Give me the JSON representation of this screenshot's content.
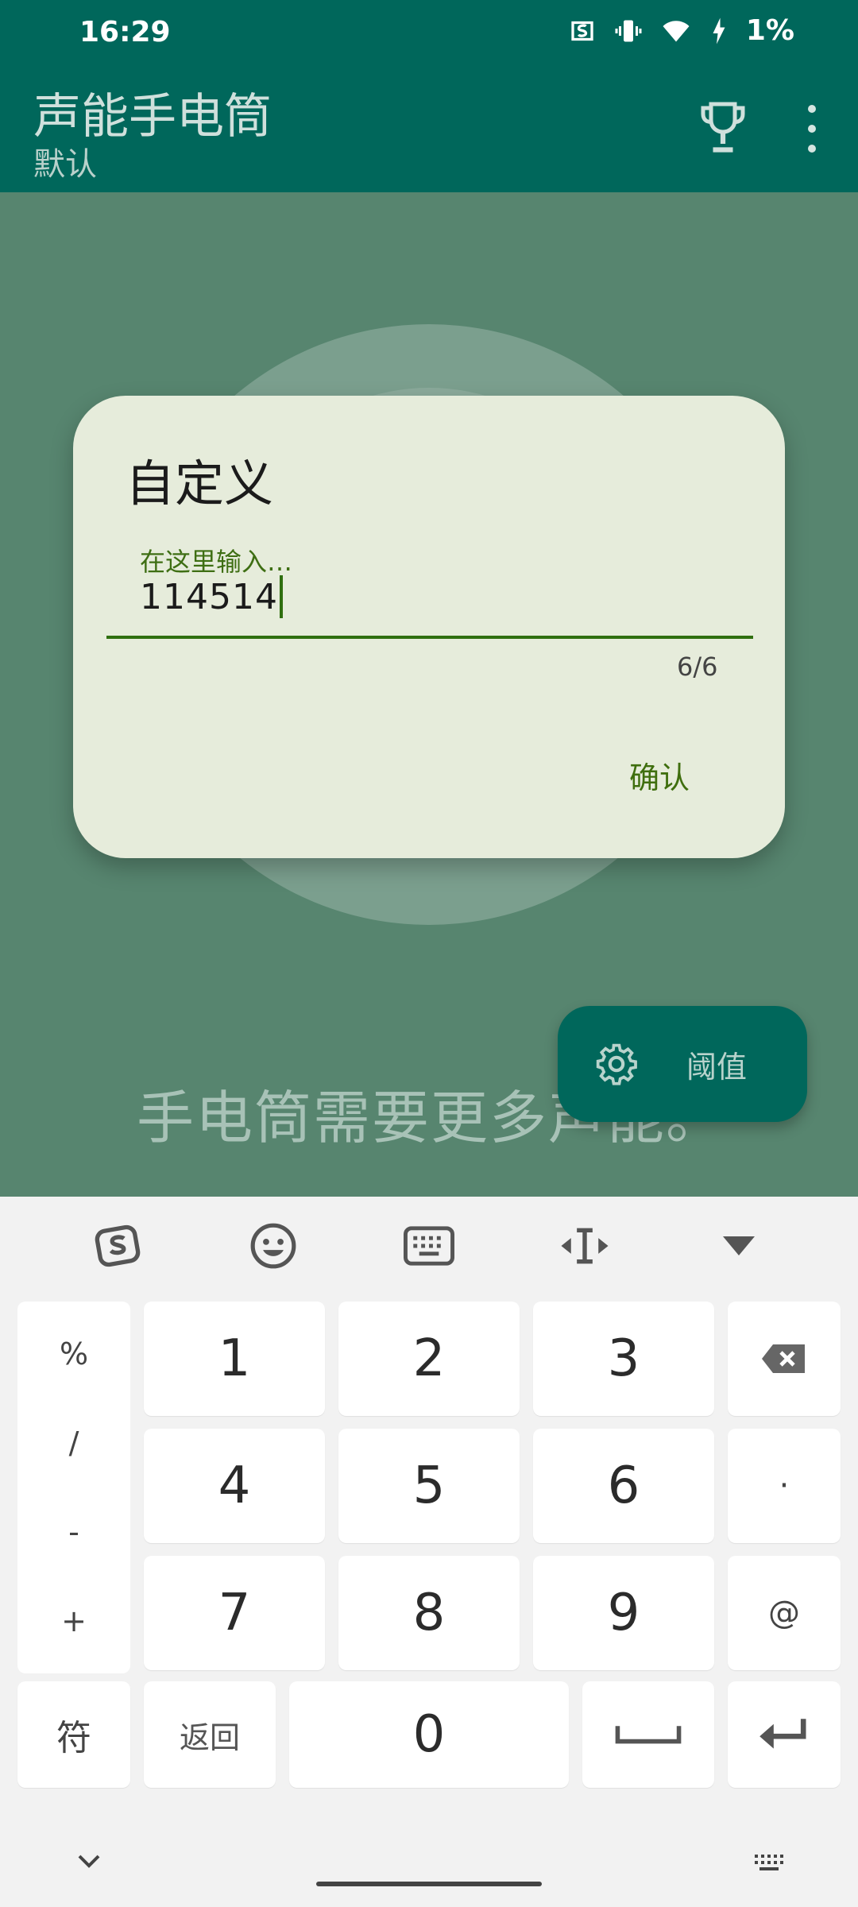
{
  "status_bar": {
    "time": "16:29",
    "battery": "1%"
  },
  "app_bar": {
    "title": "声能手电筒",
    "subtitle": "默认"
  },
  "main": {
    "hint": "手电筒需要更多声能。",
    "fab_label": "阈值"
  },
  "dialog": {
    "title": "自定义",
    "field_label": "在这里输入…",
    "field_value": "114514",
    "counter": "6/6",
    "confirm": "确认"
  },
  "keyboard": {
    "side_symbols": [
      "%",
      "/",
      "-",
      "+"
    ],
    "digits": [
      "1",
      "2",
      "3",
      "4",
      "5",
      "6",
      "7",
      "8",
      "9",
      "0"
    ],
    "dot": "·",
    "at": "@",
    "symbols_key": "符",
    "back_key": "返回"
  }
}
